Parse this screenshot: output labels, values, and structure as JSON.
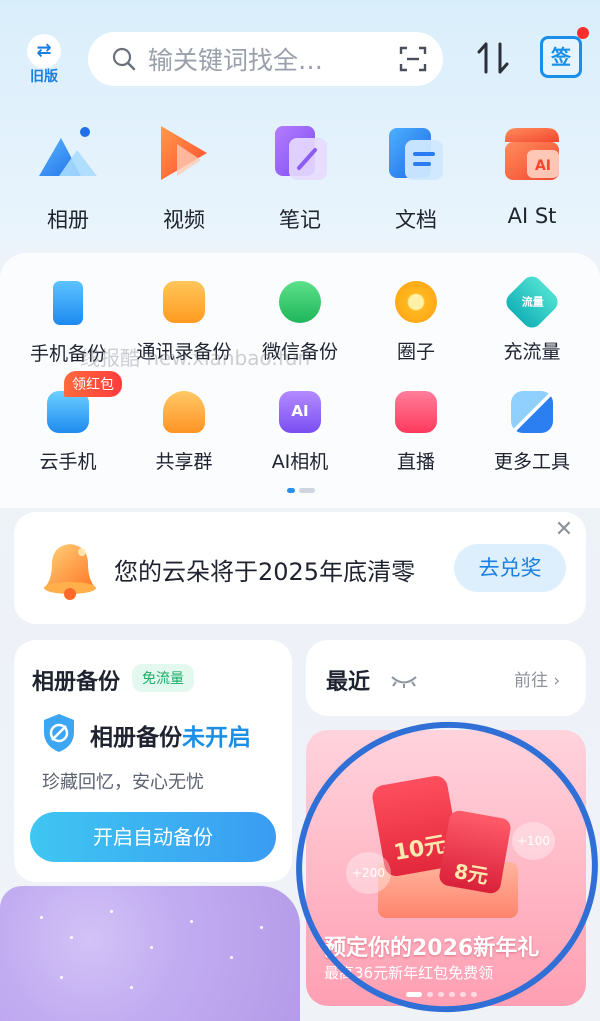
{
  "topbar": {
    "old_version_icon": "⇄",
    "old_version_label": "旧版",
    "search_placeholder": "输关键词找全…",
    "sign_label": "签"
  },
  "apps": [
    {
      "label": "相册",
      "icon": "mountain-icon"
    },
    {
      "label": "视频",
      "icon": "play-icon"
    },
    {
      "label": "笔记",
      "icon": "note-icon"
    },
    {
      "label": "文档",
      "icon": "document-icon"
    },
    {
      "label": "AI St",
      "icon": "ai-store-icon"
    }
  ],
  "tools_row1": [
    {
      "label": "手机备份"
    },
    {
      "label": "通讯录备份"
    },
    {
      "label": "微信备份"
    },
    {
      "label": "圈子"
    },
    {
      "label": "充流量",
      "icon_text": "流量"
    }
  ],
  "tools_row2": [
    {
      "label": "云手机",
      "badge": "领红包"
    },
    {
      "label": "共享群"
    },
    {
      "label": "AI相机",
      "icon_text": "AI"
    },
    {
      "label": "直播"
    },
    {
      "label": "更多工具"
    }
  ],
  "watermark": "线报酷 new.xianbao.fun",
  "notice": {
    "text": "您的云朵将于2025年底清零",
    "action": "去兑奖",
    "close": "✕"
  },
  "backup": {
    "title": "相册备份",
    "tag": "免流量",
    "status_prefix": "相册备份",
    "status_highlight": "未开启",
    "subtitle": "珍藏回忆，安心无忧",
    "cta": "开启自动备份"
  },
  "recent": {
    "title": "最近",
    "go": "前往 ›"
  },
  "promo": {
    "headline": "预定你的2026新年礼",
    "subline": "最高36元新年红包免费领",
    "env1": "10元",
    "env2": "8元",
    "points1": "+200",
    "points2": "+100"
  },
  "colors": {
    "accent": "#1a8fe8",
    "badge": "#ff3b3b",
    "green_tag": "#1fae6a"
  }
}
